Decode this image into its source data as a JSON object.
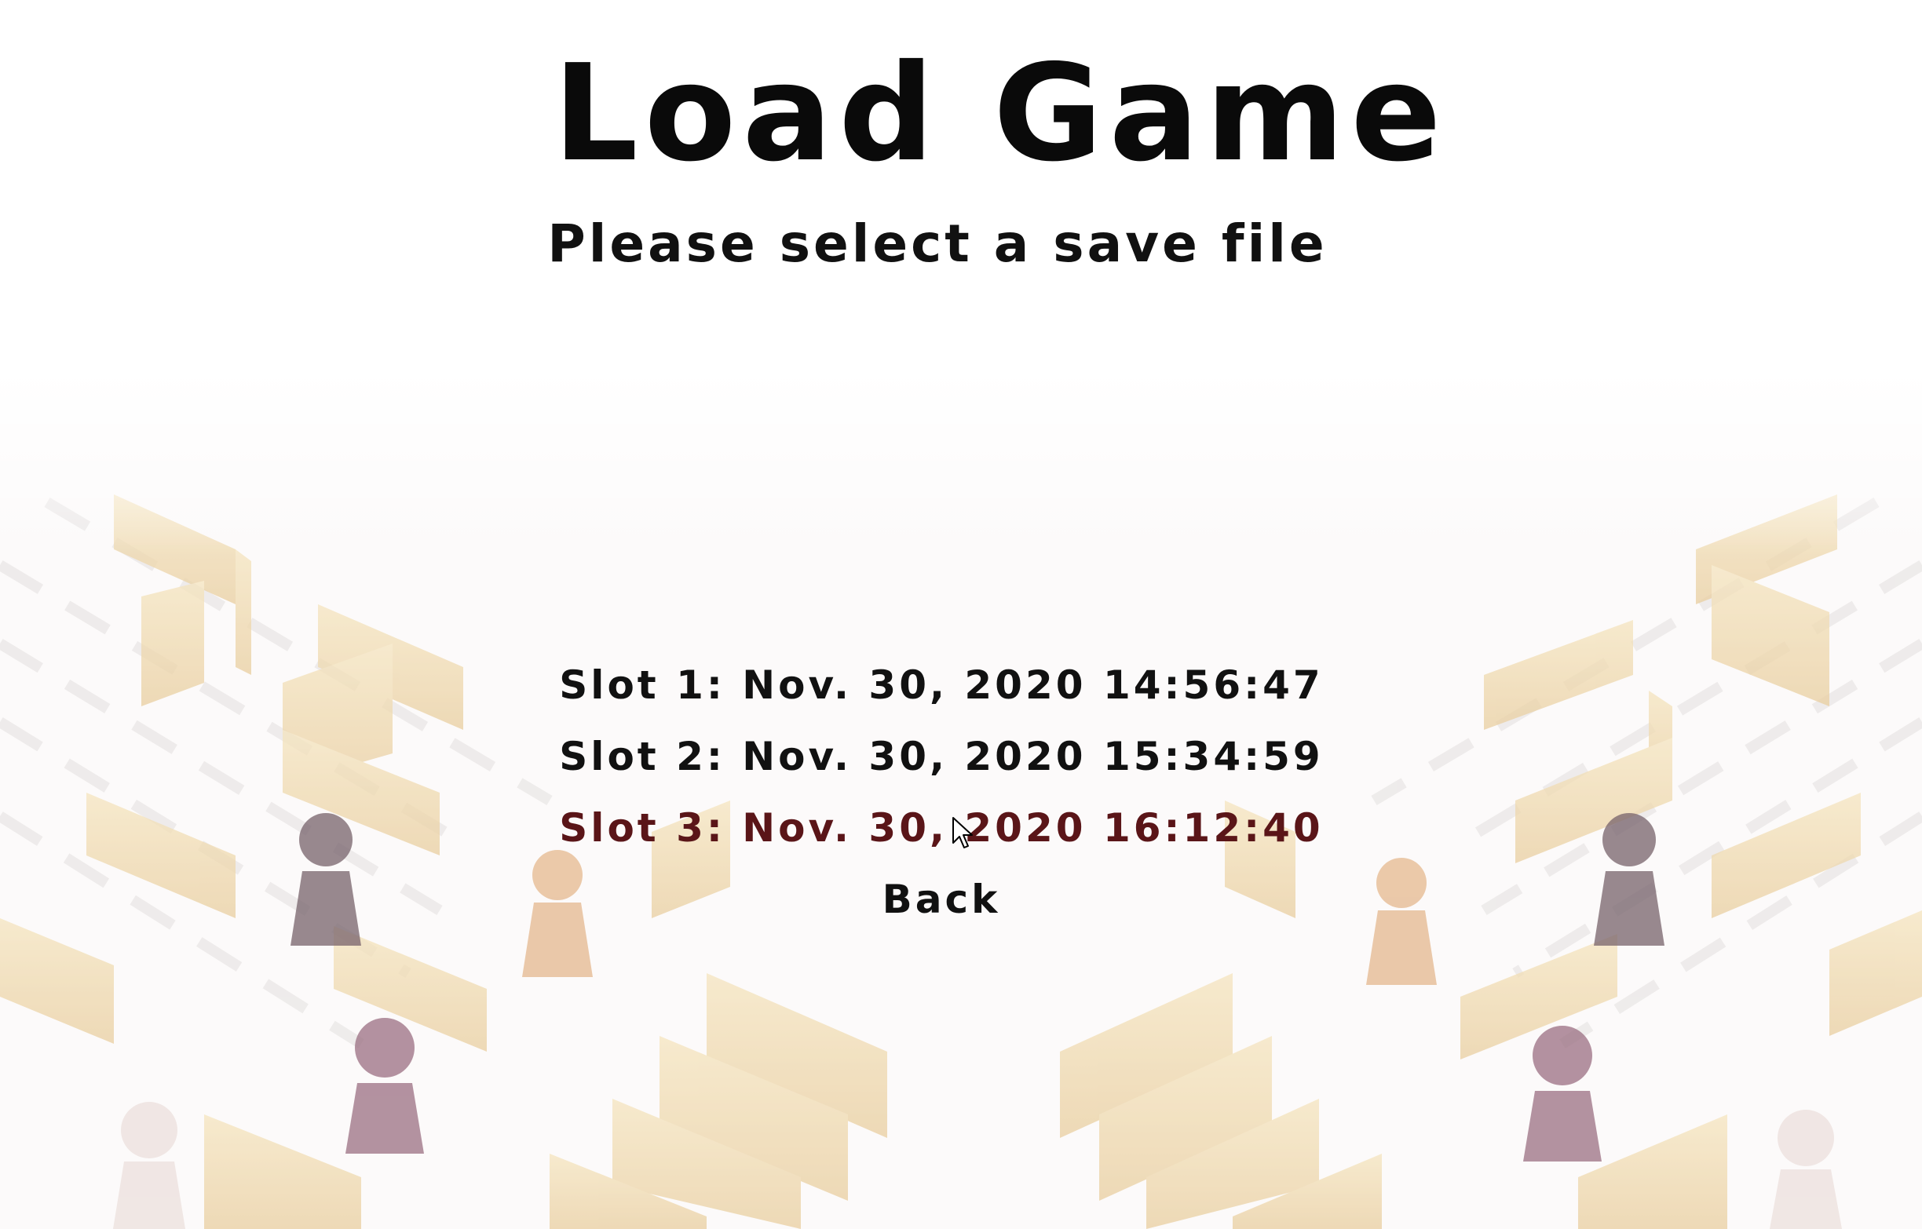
{
  "screen": {
    "title": "Load Game",
    "subtitle": "Please select a save file"
  },
  "menu": {
    "slots": [
      {
        "label": "Slot 1: Nov. 30, 2020 14:56:47",
        "hovered": false
      },
      {
        "label": "Slot 2: Nov. 30, 2020 15:34:59",
        "hovered": false
      },
      {
        "label": "Slot 3: Nov. 30, 2020 16:12:40",
        "hovered": true
      }
    ],
    "back_label": "Back"
  },
  "colors": {
    "text": "#111111",
    "hover_text": "#5a1518",
    "wood": "#e8c98a",
    "pawn_purple": "#6b3a4e",
    "pawn_brown": "#4a2e3a",
    "pawn_tan": "#d9a06a"
  },
  "icons": {
    "cursor": "arrow-cursor-icon"
  }
}
